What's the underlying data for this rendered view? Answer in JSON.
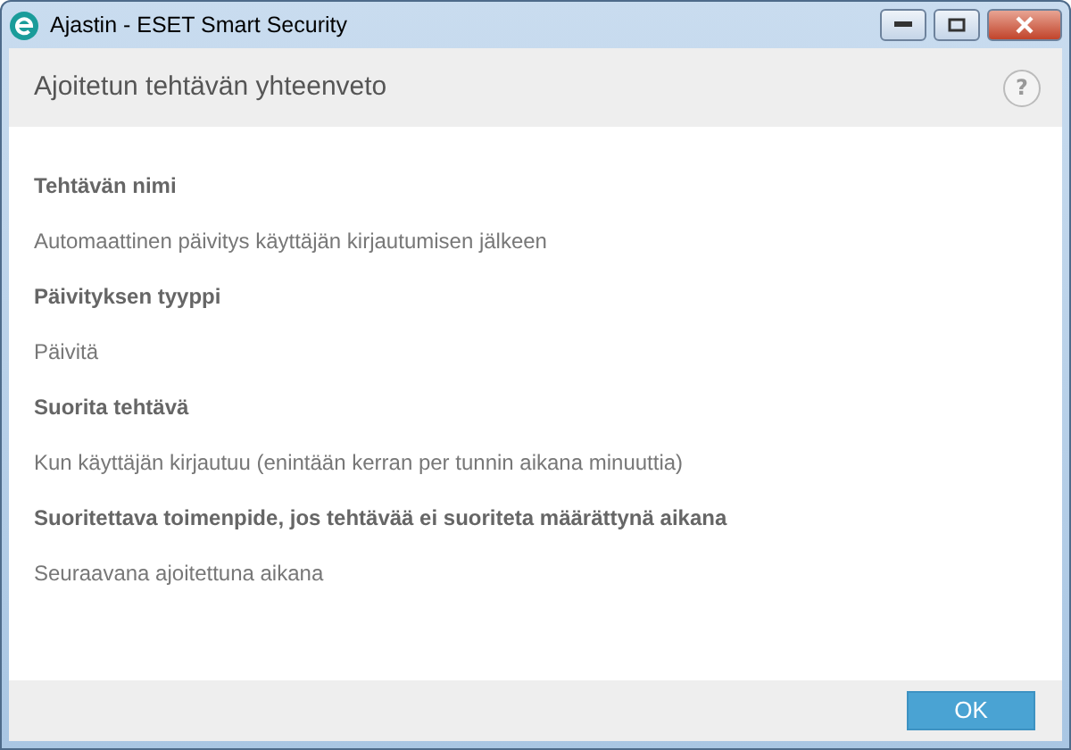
{
  "window": {
    "title": "Ajastin - ESET Smart Security"
  },
  "header": {
    "title": "Ajoitetun tehtävän yhteenveto",
    "help": "?"
  },
  "summary": [
    {
      "kind": "label",
      "text": "Tehtävän nimi"
    },
    {
      "kind": "value",
      "text": "Automaattinen päivitys käyttäjän kirjautumisen jälkeen"
    },
    {
      "kind": "label",
      "text": "Päivityksen tyyppi"
    },
    {
      "kind": "value",
      "text": "Päivitä"
    },
    {
      "kind": "label",
      "text": "Suorita tehtävä"
    },
    {
      "kind": "value",
      "text": "Kun käyttäjän kirjautuu (enintään kerran per tunnin aikana minuuttia)"
    },
    {
      "kind": "label",
      "text": "Suoritettava toimenpide, jos tehtävää ei suoriteta määrättynä aikana"
    },
    {
      "kind": "value",
      "text": "Seuraavana ajoitettuna aikana"
    }
  ],
  "buttons": [
    "OK"
  ]
}
